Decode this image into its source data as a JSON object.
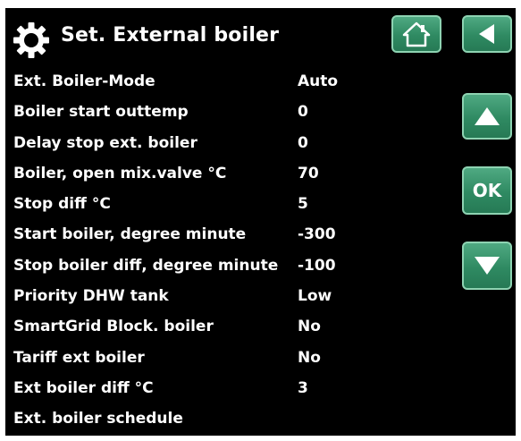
{
  "header": {
    "title": "Set. External boiler"
  },
  "buttons": {
    "ok_label": "OK"
  },
  "settings": [
    {
      "label": "Ext. Boiler-Mode",
      "value": "Auto"
    },
    {
      "label": "Boiler start outtemp",
      "value": "0"
    },
    {
      "label": "Delay stop ext. boiler",
      "value": "0"
    },
    {
      "label": "Boiler, open mix.valve °C",
      "value": "70"
    },
    {
      "label": "Stop diff °C",
      "value": "5"
    },
    {
      "label": "Start boiler, degree minute",
      "value": "-300"
    },
    {
      "label": "Stop boiler diff, degree minute",
      "value": "-100"
    },
    {
      "label": "Priority DHW tank",
      "value": "Low"
    },
    {
      "label": "SmartGrid Block. boiler",
      "value": "No"
    },
    {
      "label": "Tariff ext boiler",
      "value": "No"
    },
    {
      "label": "Ext boiler diff °C",
      "value": "3"
    },
    {
      "label": "Ext. boiler schedule",
      "value": ""
    }
  ],
  "colors": {
    "button": "#2f8a62",
    "button_border": "#8ed3b2",
    "background": "#000000",
    "text": "#ffffff"
  },
  "icons": [
    "gear-icon",
    "home-icon",
    "back-arrow-icon",
    "up-arrow-icon",
    "down-arrow-icon"
  ]
}
